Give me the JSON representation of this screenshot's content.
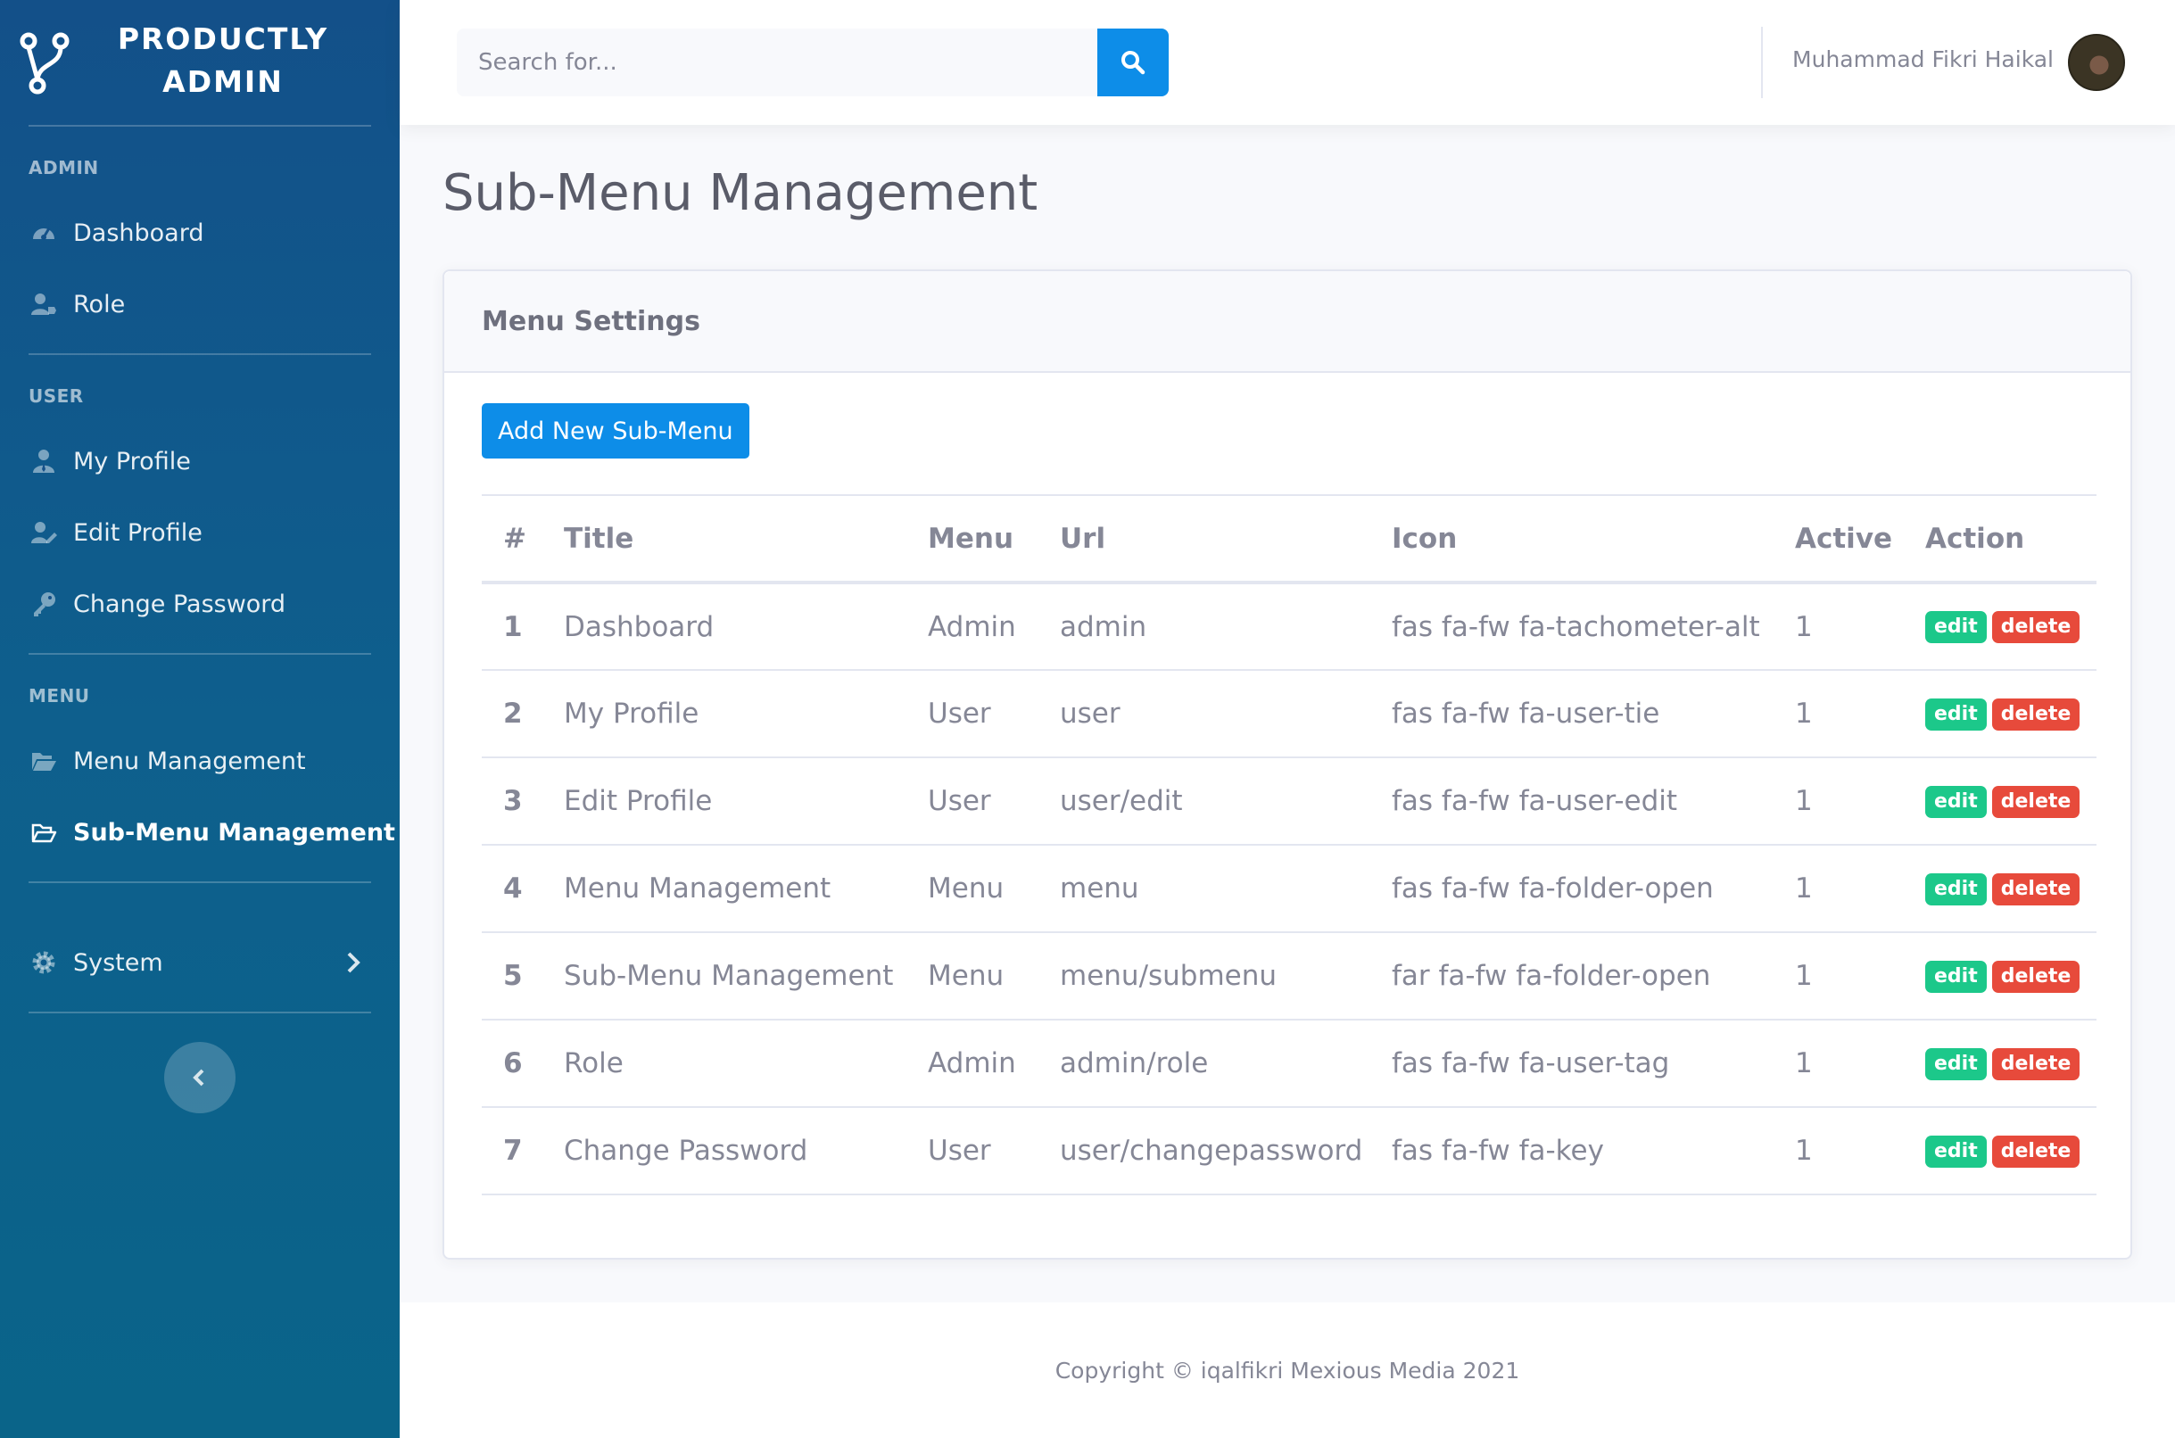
{
  "brand": {
    "line1": "PRODUCTLY",
    "line2": "ADMIN"
  },
  "sidebar": {
    "sections": [
      {
        "heading": "ADMIN",
        "items": [
          {
            "label": "Dashboard",
            "icon": "tachometer-icon"
          },
          {
            "label": "Role",
            "icon": "user-tag-icon"
          }
        ]
      },
      {
        "heading": "USER",
        "items": [
          {
            "label": "My Profile",
            "icon": "user-tie-icon"
          },
          {
            "label": "Edit Profile",
            "icon": "user-edit-icon"
          },
          {
            "label": "Change Password",
            "icon": "key-icon"
          }
        ]
      },
      {
        "heading": "MENU",
        "items": [
          {
            "label": "Menu Management",
            "icon": "folder-open-icon"
          },
          {
            "label": "Sub-Menu Management",
            "icon": "folder-open-outline-icon",
            "active": true
          }
        ]
      }
    ],
    "system": {
      "label": "System"
    }
  },
  "topbar": {
    "search_placeholder": "Search for...",
    "user_name": "Muhammad Fikri Haikal"
  },
  "page": {
    "title": "Sub-Menu Management",
    "card_title": "Menu Settings",
    "add_button": "Add New Sub-Menu"
  },
  "table": {
    "headers": [
      "#",
      "Title",
      "Menu",
      "Url",
      "Icon",
      "Active",
      "Action"
    ],
    "rows": [
      {
        "no": "1",
        "title": "Dashboard",
        "menu": "Admin",
        "url": "admin",
        "icon": "fas fa-fw fa-tachometer-alt",
        "active": "1"
      },
      {
        "no": "2",
        "title": "My Profile",
        "menu": "User",
        "url": "user",
        "icon": "fas fa-fw fa-user-tie",
        "active": "1"
      },
      {
        "no": "3",
        "title": "Edit Profile",
        "menu": "User",
        "url": "user/edit",
        "icon": "fas fa-fw fa-user-edit",
        "active": "1"
      },
      {
        "no": "4",
        "title": "Menu Management",
        "menu": "Menu",
        "url": "menu",
        "icon": "fas fa-fw fa-folder-open",
        "active": "1"
      },
      {
        "no": "5",
        "title": "Sub-Menu Management",
        "menu": "Menu",
        "url": "menu/submenu",
        "icon": "far fa-fw fa-folder-open",
        "active": "1"
      },
      {
        "no": "6",
        "title": "Role",
        "menu": "Admin",
        "url": "admin/role",
        "icon": "fas fa-fw fa-user-tag",
        "active": "1"
      },
      {
        "no": "7",
        "title": "Change Password",
        "menu": "User",
        "url": "user/changepassword",
        "icon": "fas fa-fw fa-key",
        "active": "1"
      }
    ],
    "edit_label": "edit",
    "delete_label": "delete"
  },
  "footer": {
    "text": "Copyright © iqalfikri Mexious Media 2021"
  },
  "colors": {
    "primary": "#0d8de8",
    "sidebar": "#135089",
    "success": "#1cc88a",
    "danger": "#e74a3b"
  }
}
